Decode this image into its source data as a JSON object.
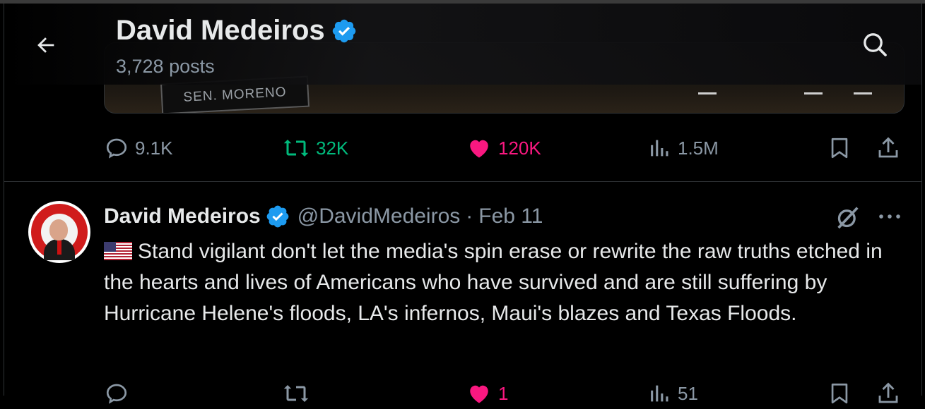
{
  "header": {
    "name": "David Medeiros",
    "posts": "3,728 posts"
  },
  "media": {
    "plaque_text": "SEN. MORENO"
  },
  "prev_tweet_actions": {
    "replies": "9.1K",
    "reposts": "32K",
    "likes": "120K",
    "views": "1.5M"
  },
  "tweet": {
    "name": "David Medeiros",
    "handle": "@DavidMedeiros",
    "separator": "·",
    "date": "Feb 11",
    "text": "Stand vigilant don't let the media's spin erase or rewrite the raw truths etched in the hearts and lives of Americans who have survived and are still suffering by Hurricane Helene's floods, LA's infernos, Maui's blazes and Texas Floods.",
    "actions": {
      "likes": "1",
      "views": "51"
    }
  },
  "colors": {
    "background": "#000000",
    "text": "#e7e9ea",
    "muted": "#8b98a5",
    "verified": "#1d9bf0",
    "repost": "#00ba7c",
    "like": "#f91880"
  },
  "icons": [
    "back-arrow-icon",
    "verified-icon",
    "search-icon",
    "reply-icon",
    "repost-icon",
    "heart-icon",
    "views-icon",
    "bookmark-icon",
    "share-icon",
    "grok-icon",
    "more-icon",
    "us-flag-icon"
  ]
}
